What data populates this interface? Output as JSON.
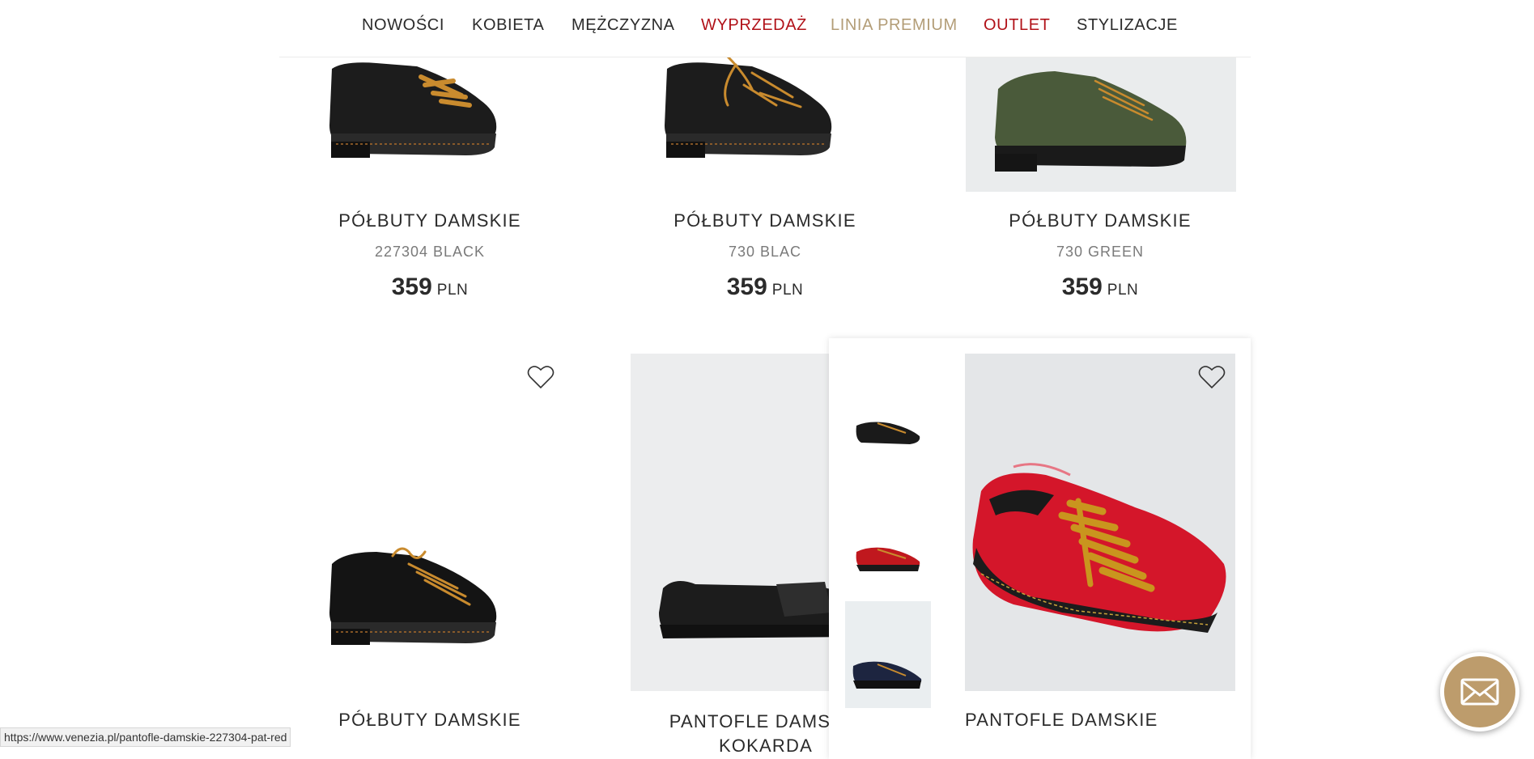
{
  "nav": {
    "items": [
      {
        "label": "NOWOŚCI"
      },
      {
        "label": "KOBIETA"
      },
      {
        "label": "MĘŻCZYZNA"
      },
      {
        "label": "WYPRZEDAŻ"
      },
      {
        "label": "LINIA PREMIUM"
      },
      {
        "label": "OUTLET"
      },
      {
        "label": "STYLIZACJE"
      }
    ],
    "colors": {
      "sale": "#b11219",
      "premium": "#b39d77",
      "outlet": "#b11219"
    }
  },
  "products_row1": [
    {
      "title": "PÓŁBUTY DAMSKIE",
      "code": "227304 BLACK",
      "price": "359",
      "currency": "PLN"
    },
    {
      "title": "PÓŁBUTY DAMSKIE",
      "code": "730 BLAC",
      "price": "359",
      "currency": "PLN"
    },
    {
      "title": "PÓŁBUTY DAMSKIE",
      "code": "730 GREEN",
      "price": "359",
      "currency": "PLN"
    }
  ],
  "products_row2": [
    {
      "title": "PÓŁBUTY DAMSKIE"
    },
    {
      "title": "PANTOFLE DAMSKIE KOKARDA"
    },
    {
      "title": "PANTOFLE DAMSKIE"
    }
  ],
  "icons": {
    "favorite": "heart-outline-icon",
    "chat": "envelope-icon"
  },
  "status_bar": {
    "url": "https://www.venezia.pl/pantofle-damskie-227304-pat-red"
  },
  "accent_color": "#bd9c6c"
}
